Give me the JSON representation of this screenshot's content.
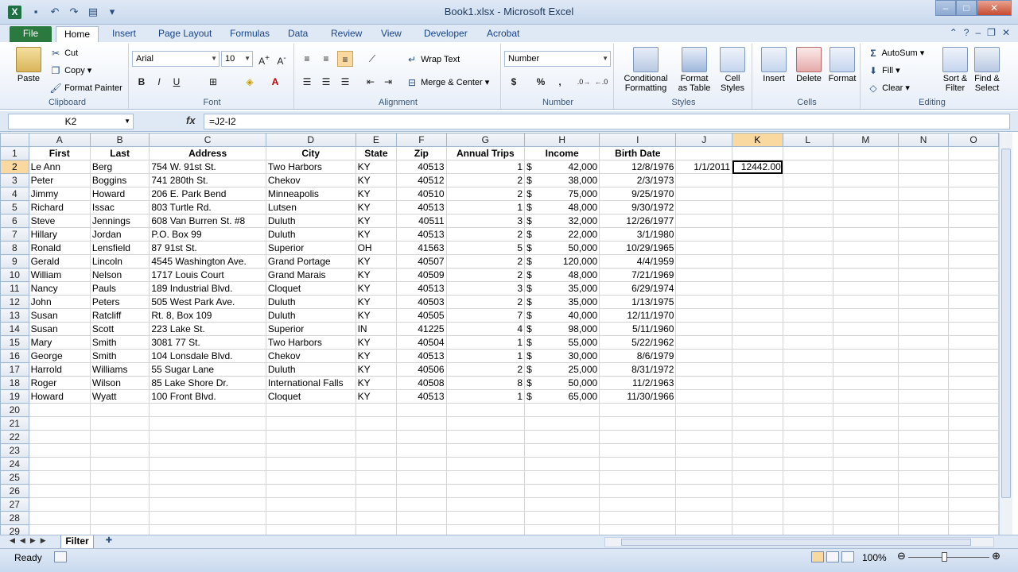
{
  "title": "Book1.xlsx - Microsoft Excel",
  "tabs": [
    "File",
    "Home",
    "Insert",
    "Page Layout",
    "Formulas",
    "Data",
    "Review",
    "View",
    "Developer",
    "Acrobat"
  ],
  "ribbon": {
    "clipboard": {
      "paste": "Paste",
      "cut": "Cut",
      "copy": "Copy",
      "format_painter": "Format Painter",
      "label": "Clipboard"
    },
    "font": {
      "name": "Arial",
      "size": "10",
      "bold": "B",
      "italic": "I",
      "underline": "U",
      "label": "Font"
    },
    "alignment": {
      "wrap": "Wrap Text",
      "merge": "Merge & Center",
      "label": "Alignment"
    },
    "number": {
      "format": "Number",
      "currency": "$",
      "percent": "%",
      "comma": ",",
      "label": "Number"
    },
    "styles": {
      "conditional": "Conditional",
      "conditional2": "Formatting",
      "format_table": "Format",
      "format_table2": "as Table",
      "cell_styles": "Cell",
      "cell_styles2": "Styles",
      "label": "Styles"
    },
    "cells": {
      "insert": "Insert",
      "delete": "Delete",
      "format": "Format",
      "label": "Cells"
    },
    "editing": {
      "autosum": "AutoSum",
      "fill": "Fill",
      "clear": "Clear",
      "sort": "Sort &",
      "sort2": "Filter",
      "find": "Find &",
      "find2": "Select",
      "label": "Editing"
    }
  },
  "formula_bar": {
    "name_box": "K2",
    "fx": "fx",
    "formula": "=J2-I2"
  },
  "columns": [
    "A",
    "B",
    "C",
    "D",
    "E",
    "F",
    "G",
    "H",
    "I",
    "J",
    "K",
    "L",
    "M",
    "N",
    "O"
  ],
  "headers": [
    "First",
    "Last",
    "Address",
    "City",
    "State",
    "Zip",
    "Annual Trips",
    "Income",
    "Birth Date"
  ],
  "rows": [
    [
      "Le Ann",
      "Berg",
      "754 W. 91st St.",
      "Two Harbors",
      "KY",
      "40513",
      "1",
      "42,000",
      "12/8/1976"
    ],
    [
      "Peter",
      "Boggins",
      "741 280th St.",
      "Chekov",
      "KY",
      "40512",
      "2",
      "38,000",
      "2/3/1973"
    ],
    [
      "Jimmy",
      "Howard",
      "206 E. Park Bend",
      "Minneapolis",
      "KY",
      "40510",
      "2",
      "75,000",
      "9/25/1970"
    ],
    [
      "Richard",
      "Issac",
      "803 Turtle Rd.",
      "Lutsen",
      "KY",
      "40513",
      "1",
      "48,000",
      "9/30/1972"
    ],
    [
      "Steve",
      "Jennings",
      "608 Van Burren St. #8",
      "Duluth",
      "KY",
      "40511",
      "3",
      "32,000",
      "12/26/1977"
    ],
    [
      "Hillary",
      "Jordan",
      "P.O. Box 99",
      "Duluth",
      "KY",
      "40513",
      "2",
      "22,000",
      "3/1/1980"
    ],
    [
      "Ronald",
      "Lensfield",
      "87 91st St.",
      "Superior",
      "OH",
      "41563",
      "5",
      "50,000",
      "10/29/1965"
    ],
    [
      "Gerald",
      "Lincoln",
      "4545 Washington Ave.",
      "Grand Portage",
      "KY",
      "40507",
      "2",
      "120,000",
      "4/4/1959"
    ],
    [
      "William",
      "Nelson",
      "1717 Louis Court",
      "Grand Marais",
      "KY",
      "40509",
      "2",
      "48,000",
      "7/21/1969"
    ],
    [
      "Nancy",
      "Pauls",
      "189 Industrial Blvd.",
      "Cloquet",
      "KY",
      "40513",
      "3",
      "35,000",
      "6/29/1974"
    ],
    [
      "John",
      "Peters",
      "505 West Park Ave.",
      "Duluth",
      "KY",
      "40503",
      "2",
      "35,000",
      "1/13/1975"
    ],
    [
      "Susan",
      "Ratcliff",
      "Rt. 8, Box 109",
      "Duluth",
      "KY",
      "40505",
      "7",
      "40,000",
      "12/11/1970"
    ],
    [
      "Susan",
      "Scott",
      "223 Lake St.",
      "Superior",
      "IN",
      "41225",
      "4",
      "98,000",
      "5/11/1960"
    ],
    [
      "Mary",
      "Smith",
      "3081 77 St.",
      "Two Harbors",
      "KY",
      "40504",
      "1",
      "55,000",
      "5/22/1962"
    ],
    [
      "George",
      "Smith",
      "104 Lonsdale Blvd.",
      "Chekov",
      "KY",
      "40513",
      "1",
      "30,000",
      "8/6/1979"
    ],
    [
      "Harrold",
      "Williams",
      "55 Sugar Lane",
      "Duluth",
      "KY",
      "40506",
      "2",
      "25,000",
      "8/31/1972"
    ],
    [
      "Roger",
      "Wilson",
      "85 Lake Shore Dr.",
      "International Falls",
      "KY",
      "40508",
      "8",
      "50,000",
      "11/2/1963"
    ],
    [
      "Howard",
      "Wyatt",
      "100 Front Blvd.",
      "Cloquet",
      "KY",
      "40513",
      "1",
      "65,000",
      "11/30/1966"
    ]
  ],
  "currency_symbol": "$",
  "j2": "1/1/2011",
  "k2": "12442.00",
  "sheet_tab": "Filter",
  "status": {
    "ready": "Ready",
    "zoom": "100%"
  }
}
